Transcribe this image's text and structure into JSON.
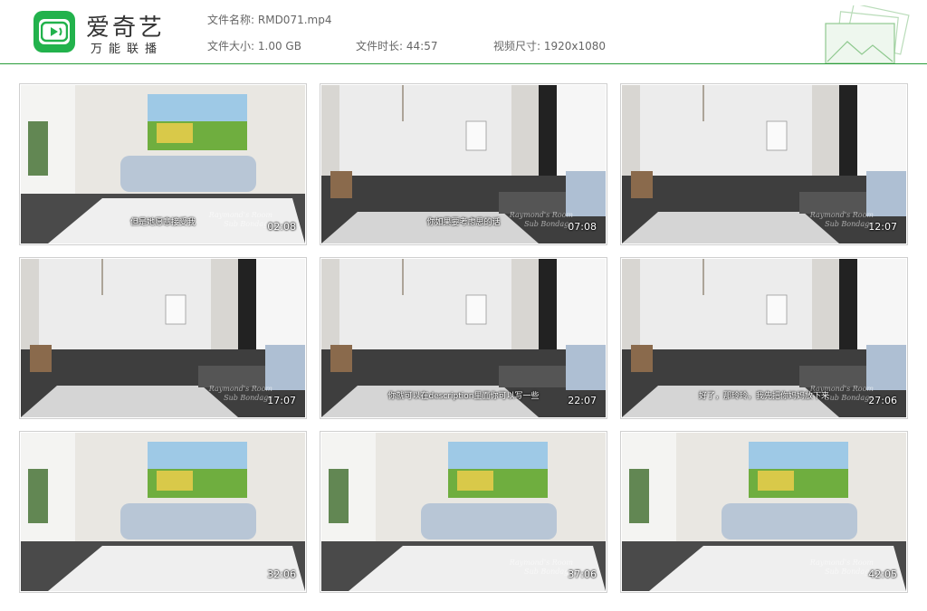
{
  "brand": {
    "title": "爱奇艺",
    "subtitle": "万能联播",
    "logo_icon": "iqiyi-tv-logo-icon",
    "accent_color": "#22b24c"
  },
  "file_info": {
    "name_label": "文件名称:",
    "name_value": "RMD071.mp4",
    "size_label": "文件大小:",
    "size_value": "1.00 GB",
    "duration_label": "文件时长:",
    "duration_value": "44:57",
    "resolution_label": "视频尺寸:",
    "resolution_value": "1920x1080"
  },
  "decoration_icon": "picture-frames-icon",
  "thumbnails": [
    {
      "timestamp": "02:08",
      "subtitle": "但是她愿意接受我",
      "watermark": "Raymond's Room\nSub Bondage",
      "scene": "living-room"
    },
    {
      "timestamp": "07:08",
      "subtitle": "你如果要考虑思的话",
      "watermark": "Raymond's Room\nSub Bondage",
      "scene": "suspension"
    },
    {
      "timestamp": "12:07",
      "subtitle": "",
      "watermark": "Raymond's Room\nSub Bondage",
      "scene": "suspension"
    },
    {
      "timestamp": "17:07",
      "subtitle": "",
      "watermark": "Raymond's Room\nSub Bondage",
      "scene": "suspension"
    },
    {
      "timestamp": "22:07",
      "subtitle": "你就可以在description里面你可以写一些",
      "watermark": "",
      "scene": "suspension"
    },
    {
      "timestamp": "27:06",
      "subtitle": "好了，那玲玲，我先把你妈妈放下来",
      "watermark": "Raymond's Room\nSub Bondage",
      "scene": "suspension"
    },
    {
      "timestamp": "32:06",
      "subtitle": "",
      "watermark": "",
      "scene": "living-room"
    },
    {
      "timestamp": "37:06",
      "subtitle": "",
      "watermark": "Raymond's Room\nSub Bondage",
      "scene": "living-room"
    },
    {
      "timestamp": "42:05",
      "subtitle": "",
      "watermark": "Raymond's Room\nSub Bondage",
      "scene": "living-room"
    }
  ]
}
